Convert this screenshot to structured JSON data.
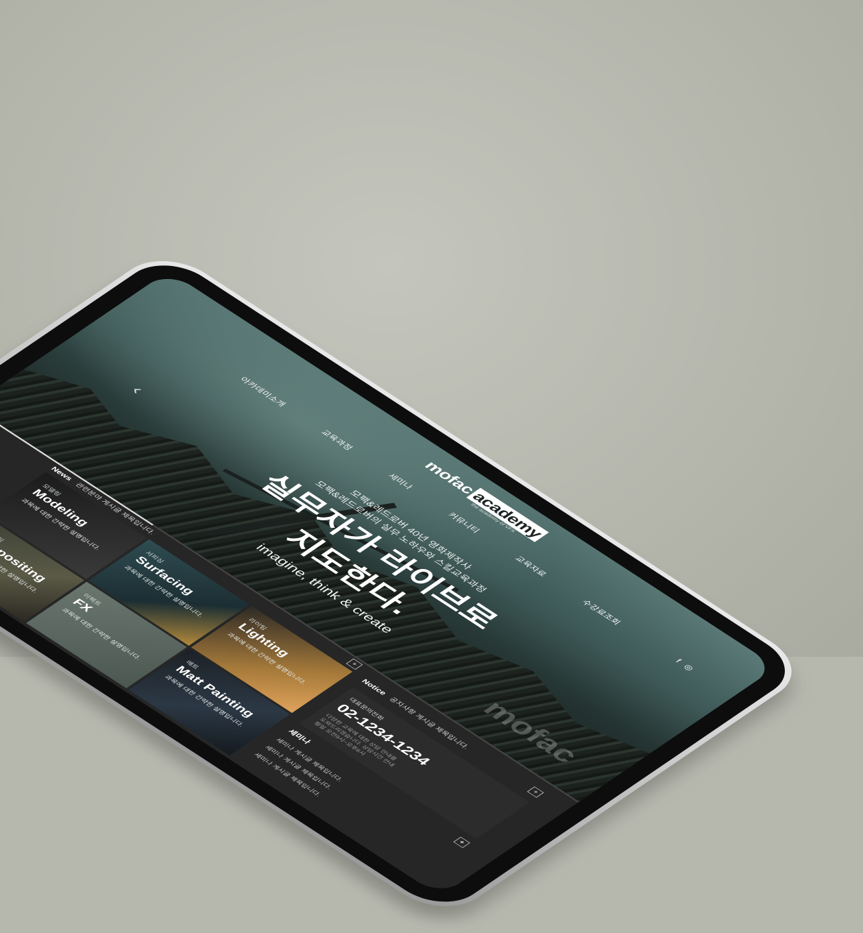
{
  "brand": {
    "logo_main": "mofac",
    "logo_accent": "academy",
    "logo_sub": "the academy of VFX",
    "watermark": "mofac"
  },
  "nav": {
    "items": [
      "아카데미소개",
      "교육과정",
      "세미나",
      "커뮤니티",
      "교육자료",
      "수강료조회"
    ],
    "icons": [
      "f",
      "◎"
    ]
  },
  "hero": {
    "sub1": "모팩&레드로버 40년 영화제작사",
    "sub2": "모팩&레드로버의 실무 노하우와 스킬교육과정",
    "headline1": "실무자가 라이브로",
    "headline2": "지도한다.",
    "tagline": "imagine, think & create",
    "progress": 0.3
  },
  "news": {
    "label": "News",
    "text": "관련분야 게시글 제목입니다."
  },
  "notice": {
    "label": "Notice",
    "text": "공지사항 게시글 제목입니다."
  },
  "courses": [
    {
      "cat": "모델링",
      "title": "Modeling",
      "desc": "과목에 대한 간략한 설명입니다."
    },
    {
      "cat": "서피싱",
      "title": "Surfacing",
      "desc": "과목에 대한 간략한 설명입니다."
    },
    {
      "cat": "라이팅",
      "title": "Lighting",
      "desc": "과목에 대한 간략한 설명입니다."
    },
    {
      "cat": "컴포지팅",
      "title": "Compositing",
      "desc": "과목에 대한 간략한 설명입니다."
    },
    {
      "cat": "이펙트",
      "title": "FX",
      "desc": "과목에 대한 간략한 설명입니다."
    },
    {
      "cat": "매트",
      "title": "Matt Painting",
      "desc": "과목에 대한 간략한 설명입니다."
    }
  ],
  "contact": {
    "label": "대표문의전화",
    "phone": "02-1234-1234",
    "note1": "다양한 교육에 대한 상담 안내를",
    "note2": "도와드리겠습니다. 상담시간 안내",
    "note3": "평일 오전9시~오후6시"
  },
  "seminar": {
    "title": "세미나",
    "items": [
      "세미나 게시글 제목입니다.",
      "세미나 게시글 제목입니다.",
      "세미나 게시글 제목입니다."
    ]
  },
  "plus": "+"
}
